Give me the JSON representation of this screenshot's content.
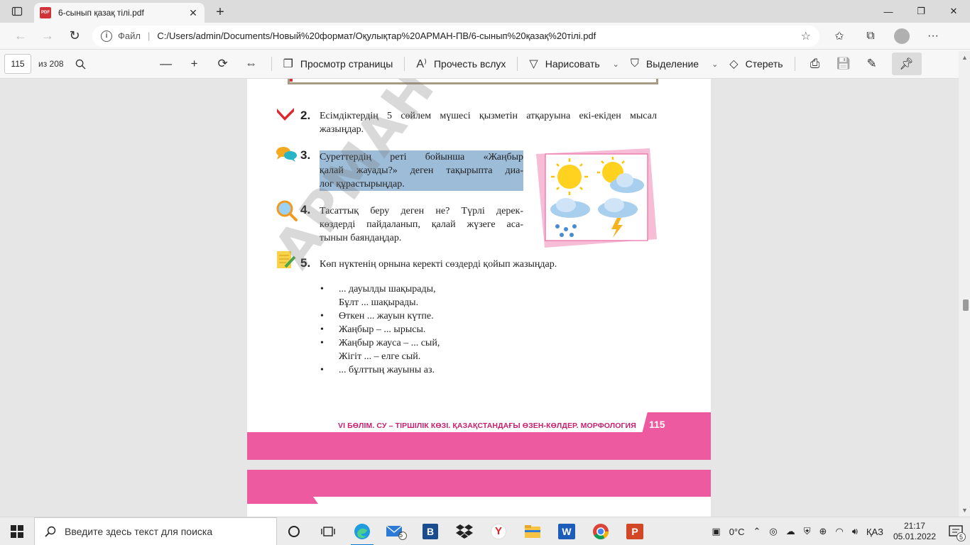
{
  "browser": {
    "tab_title": "6-сынып қазақ тілі.pdf",
    "tab_icon": "pdf-icon",
    "url_scheme": "Файл",
    "url_path": "C:/Users/admin/Documents/Новый%20формат/Оқулықтар%20АРМАН-ПВ/6-сынып%20қазақ%20тілі.pdf"
  },
  "pdf_toolbar": {
    "page_current": "115",
    "page_total": "из 208",
    "page_view": "Просмотр страницы",
    "read_aloud": "Прочесть вслух",
    "draw": "Нарисовать",
    "highlight": "Выделение",
    "erase": "Стереть"
  },
  "document": {
    "watermark": "АРМАН-ПВ",
    "tasks": [
      {
        "num": "2.",
        "text": "Есімдіктердің 5 сөйлем мүшесі қызметін атқаруына екі-екіден мысал жазыңдар.",
        "icon": "check-icon"
      },
      {
        "num": "3.",
        "text_lines": [
          "Суреттердің реті бойынша «Жаңбыр",
          "қалай жауады?» деген тақырыпта диа-",
          "лог құрастырыңдар."
        ],
        "icon": "chat-bubbles-icon"
      },
      {
        "num": "4.",
        "text_lines": [
          "Тасаттық беру деген не? Түрлі дерек-",
          "көздерді пайдаланып, қалай жүзеге аса-",
          "тынын баяндаңдар."
        ],
        "icon": "magnifier-icon"
      },
      {
        "num": "5.",
        "text": "Көп нүктенің орнына керекті сөздерді қойып жазыңдар.",
        "icon": "notepad-pencil-icon"
      }
    ],
    "bullets": [
      {
        "bullet": "•",
        "text": "... дауылды шақырады,"
      },
      {
        "bullet": "",
        "text": "Бұлт ... шақырады."
      },
      {
        "bullet": "•",
        "text": "Өткен ... жауын күтпе."
      },
      {
        "bullet": "•",
        "text": "Жаңбыр – ... ырысы."
      },
      {
        "bullet": "•",
        "text": "Жаңбыр жауса  – ... сый,"
      },
      {
        "bullet": "",
        "text": "Жігіт ...  – елге сый."
      },
      {
        "bullet": "•",
        "text": "... бұлттың жауыны аз."
      }
    ],
    "footer_text": "VI БӨЛІМ. СУ – ТІРШІЛІК КӨЗІ. ҚАЗАҚСТАНДАҒЫ ӨЗЕН-КӨЛДЕР. МОРФОЛОГИЯ",
    "page_number": "115"
  },
  "taskbar": {
    "search_placeholder": "Введите здесь текст для поиска",
    "temperature": "0°C",
    "language": "ҚАЗ",
    "time": "21:17",
    "date": "05.01.2022",
    "mail_badge": "5",
    "notification_badge": "5"
  },
  "colors": {
    "accent_pink": "#ee5aa0",
    "highlight_blue": "#9dbcd8",
    "edge_blue": "#0078d4"
  }
}
